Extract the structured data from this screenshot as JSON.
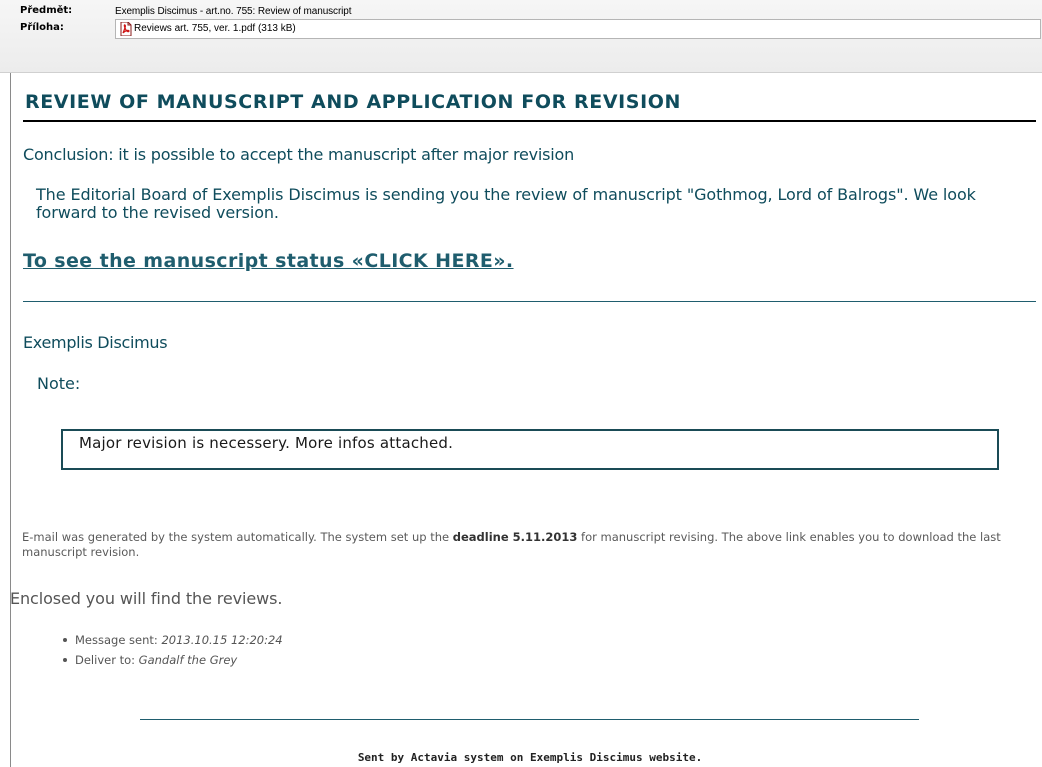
{
  "header": {
    "subject_label": "Předmět:",
    "subject_value": "Exemplis Discimus - art.no. 755: Review of manuscript",
    "attachment_label": "Příloha:",
    "attachment_icon": "pdf-file-icon",
    "attachment_name": "Reviews art. 755, ver. 1.pdf (313 kB)"
  },
  "body": {
    "title": "REVIEW OF MANUSCRIPT AND APPLICATION FOR REVISION",
    "conclusion": "Conclusion: it is possible to accept the manuscript after major revision",
    "intro": "The Editorial Board of Exemplis Discimus is sending you the review of manuscript \"Gothmog, Lord of Balrogs\". We look forward to the revised version.",
    "status_link": "To see the manuscript status «CLICK HERE».",
    "journal_name": "Exemplis Discimus",
    "note_label": "Note:",
    "note_text": "Major revision is necessery. More infos attached.",
    "system_msg_part1": "E-mail was generated by the system automatically. The system set up the ",
    "system_msg_deadline": "deadline 5.11.2013",
    "system_msg_part2": " for manuscript revising. The above link enables you to download the last manuscript revision.",
    "enclosed": "Enclosed you will find the reviews.",
    "message_sent_label": "Message sent: ",
    "message_sent_value": "2013.10.15 12:20:24",
    "deliver_to_label": "Deliver to: ",
    "deliver_to_value": "Gandalf the Grey",
    "footer": "Sent by Actavia system on Exemplis Discimus website."
  },
  "colors": {
    "heading": "#0f4c5c",
    "link": "#1f5d6e",
    "note_border": "#1a4b56"
  }
}
